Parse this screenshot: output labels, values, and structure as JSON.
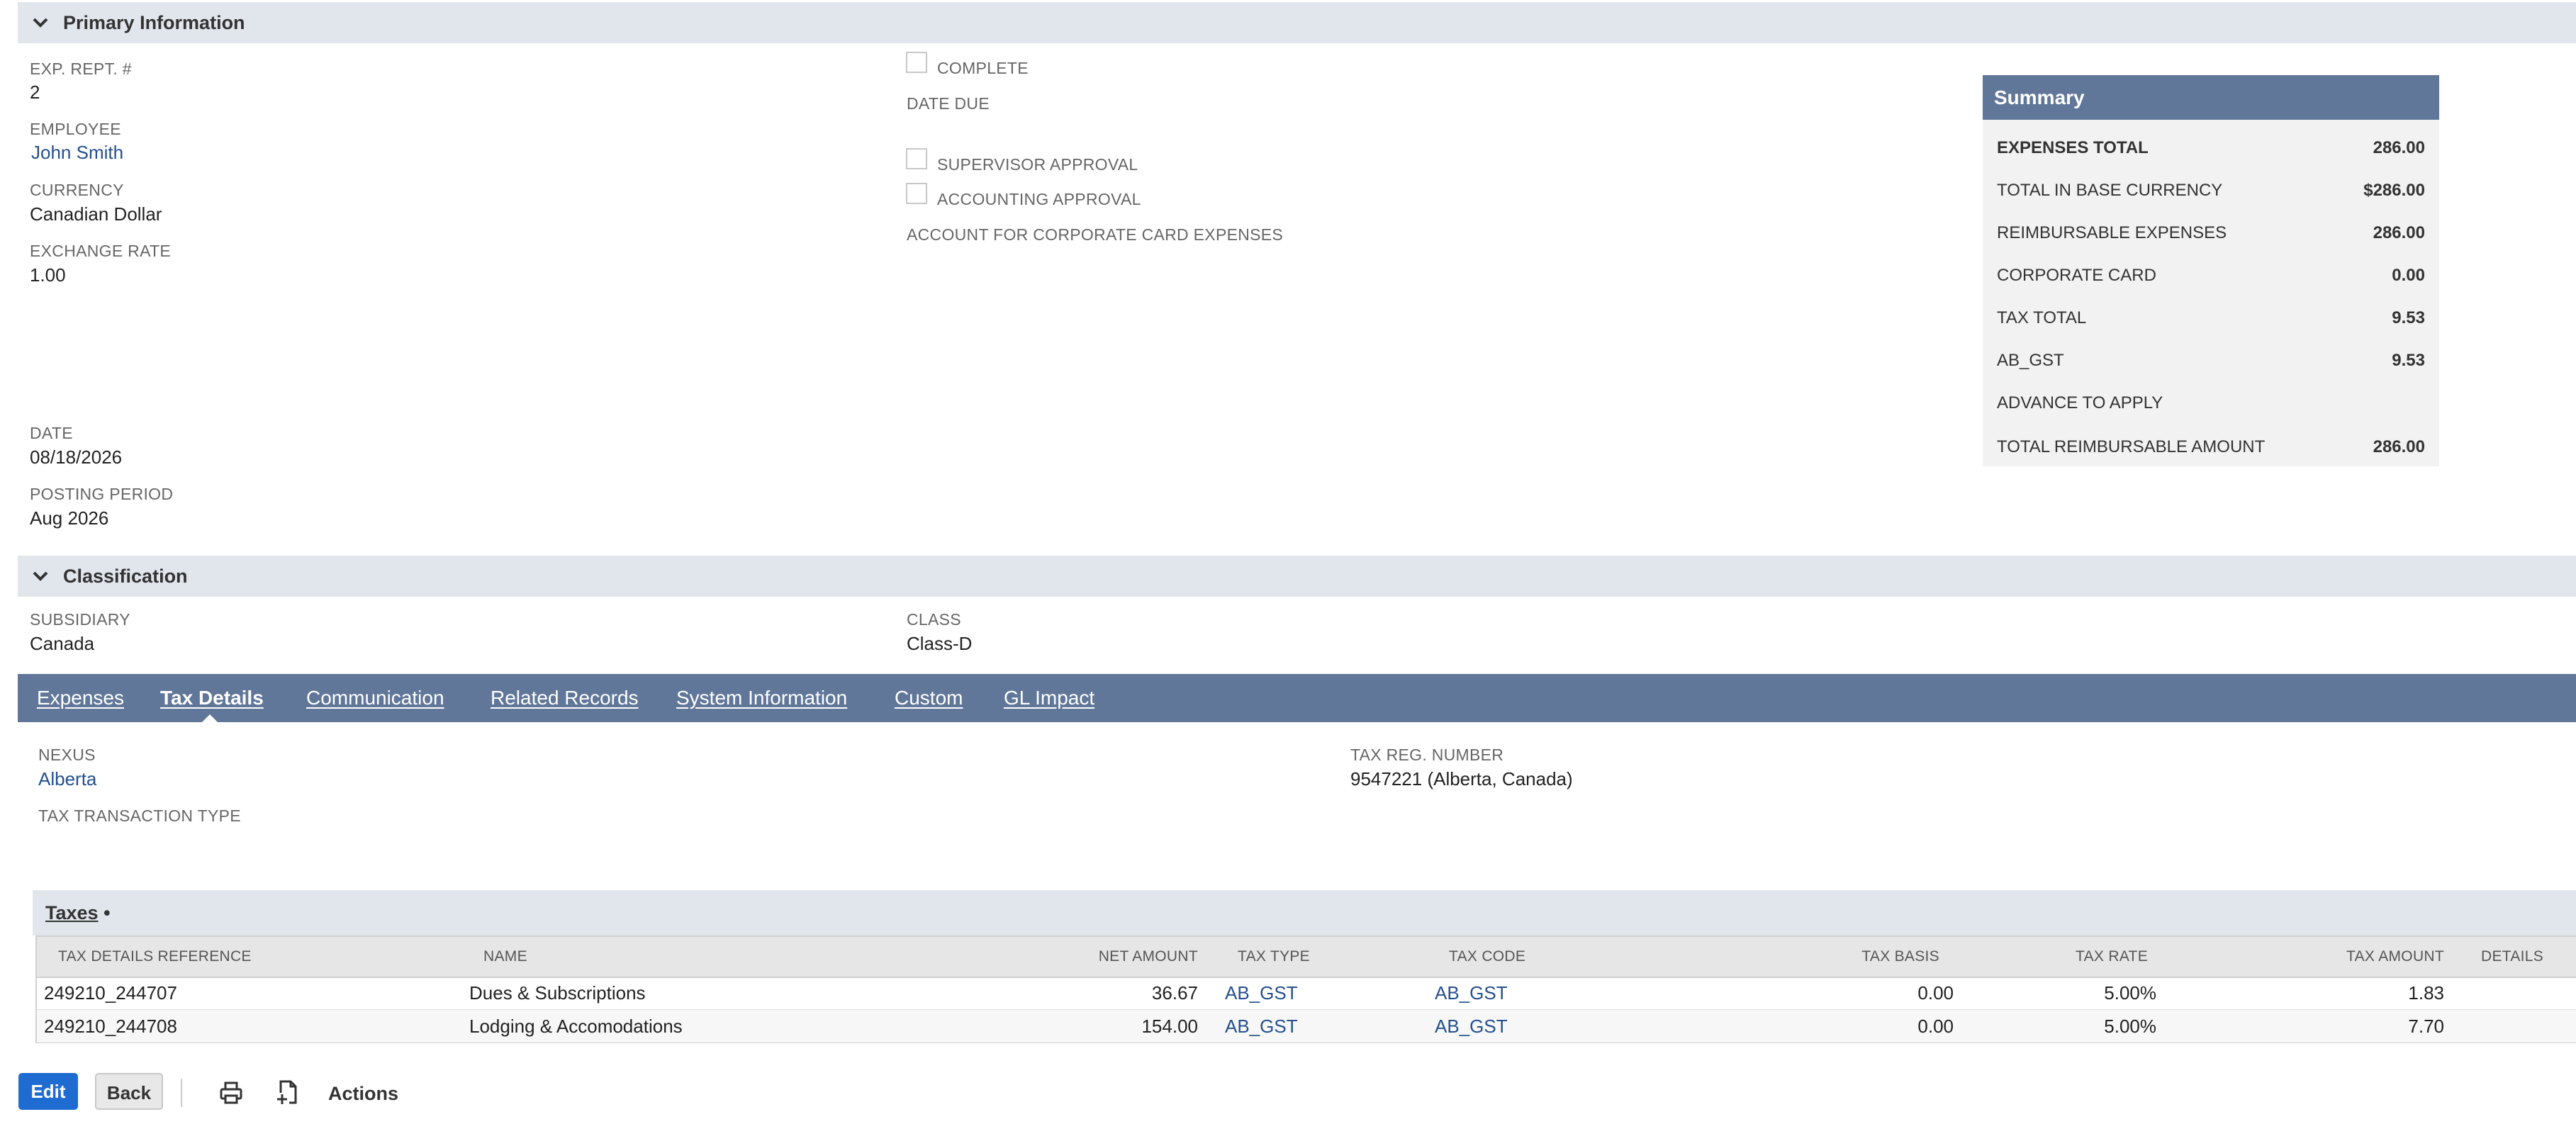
{
  "primary_info": {
    "section_title": "Primary Information",
    "exp_rept_label": "EXP. REPT. #",
    "exp_rept_value": "2",
    "employee_label": "EMPLOYEE",
    "employee_value": "John Smith",
    "currency_label": "CURRENCY",
    "currency_value": "Canadian Dollar",
    "exchange_rate_label": "EXCHANGE RATE",
    "exchange_rate_value": "1.00",
    "date_label": "DATE",
    "date_value": "08/18/2026",
    "posting_period_label": "POSTING PERIOD",
    "posting_period_value": "Aug 2026",
    "complete_label": "COMPLETE",
    "date_due_label": "DATE DUE",
    "supervisor_approval_label": "SUPERVISOR APPROVAL",
    "accounting_approval_label": "ACCOUNTING APPROVAL",
    "corp_card_account_label": "ACCOUNT FOR CORPORATE CARD EXPENSES"
  },
  "summary": {
    "title": "Summary",
    "rows": [
      {
        "label": "EXPENSES TOTAL",
        "value": "286.00"
      },
      {
        "label": "TOTAL IN BASE CURRENCY",
        "value": "$286.00"
      },
      {
        "label": "REIMBURSABLE EXPENSES",
        "value": "286.00"
      },
      {
        "label": "CORPORATE CARD",
        "value": "0.00"
      },
      {
        "label": "TAX TOTAL",
        "value": "9.53"
      },
      {
        "label": "AB_GST",
        "value": "9.53"
      },
      {
        "label": "ADVANCE TO APPLY",
        "value": ""
      },
      {
        "label": "TOTAL REIMBURSABLE AMOUNT",
        "value": "286.00"
      }
    ]
  },
  "classification": {
    "section_title": "Classification",
    "subsidiary_label": "SUBSIDIARY",
    "subsidiary_value": "Canada",
    "class_label": "CLASS",
    "class_value": "Class-D"
  },
  "tabs": [
    {
      "label": "Expenses"
    },
    {
      "label": "Tax Details"
    },
    {
      "label": "Communication"
    },
    {
      "label": "Related Records"
    },
    {
      "label": "System Information"
    },
    {
      "label": "Custom"
    },
    {
      "label": "GL Impact"
    }
  ],
  "tax_details": {
    "nexus_label": "NEXUS",
    "nexus_value": "Alberta",
    "tax_reg_label": "TAX REG. NUMBER",
    "tax_reg_value": "9547221 (Alberta, Canada)",
    "tax_txn_type_label": "TAX TRANSACTION TYPE"
  },
  "taxes": {
    "tab_label": "Taxes",
    "tab_marker": "•",
    "columns": [
      "TAX DETAILS REFERENCE",
      "NAME",
      "NET AMOUNT",
      "TAX TYPE",
      "TAX CODE",
      "TAX BASIS",
      "TAX RATE",
      "TAX AMOUNT",
      "DETAILS"
    ],
    "rows": [
      {
        "ref": "249210_244707",
        "name": "Dues & Subscriptions",
        "net": "36.67",
        "type": "AB_GST",
        "code": "AB_GST",
        "basis": "0.00",
        "rate": "5.00%",
        "amount": "1.83",
        "details": ""
      },
      {
        "ref": "249210_244708",
        "name": "Lodging & Accomodations",
        "net": "154.00",
        "type": "AB_GST",
        "code": "AB_GST",
        "basis": "0.00",
        "rate": "5.00%",
        "amount": "7.70",
        "details": ""
      }
    ]
  },
  "actions": {
    "edit_label": "Edit",
    "back_label": "Back",
    "actions_label": "Actions",
    "icons": [
      "print-icon",
      "new-document-icon"
    ]
  },
  "colors": {
    "tab_bar": "#607799",
    "section_header": "#e1e5ec",
    "link": "#24508e",
    "primary_button": "#1e6bd1"
  }
}
